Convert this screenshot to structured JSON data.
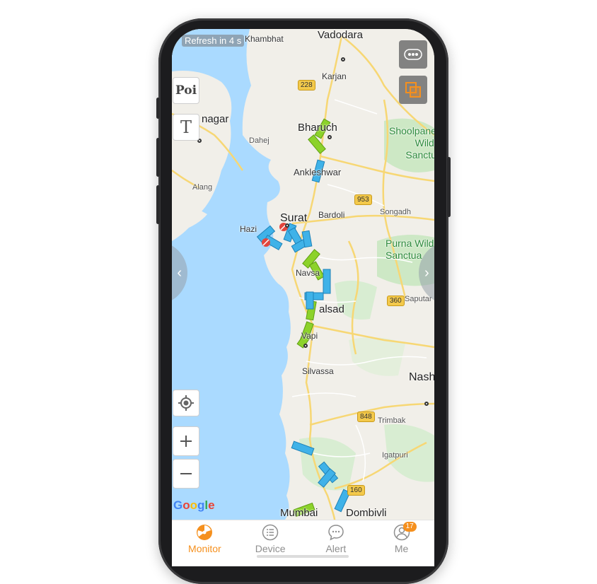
{
  "status": {
    "refresh_text": "Refresh in 4 s"
  },
  "map": {
    "labels": {
      "khambhat": "Khambhat",
      "vadodara": "Vadodara",
      "karjan": "Karjan",
      "nagar": "nagar",
      "bharuch": "Bharuch",
      "dahej": "Dahej",
      "shoolpaneshwar": "Shoolpane\nWildl\nSanctu",
      "ankleshwar": "Ankleshwar",
      "alang": "Alang",
      "surat": "Surat",
      "bardoli": "Bardoli",
      "songadh": "Songadh",
      "hazira": "Hazi",
      "purna": "Purna Wild\nSanctua",
      "navsari": "Navsa",
      "valsad": "alsad",
      "saputara": "Saputar",
      "vapi": "Vapi",
      "silvassa": "Silvassa",
      "nashik": "Nash",
      "trimbak": "Trimbak",
      "igatpuri": "Igatpuri",
      "mumbai": "Mumbai",
      "dombivli": "Dombivli"
    },
    "shields": {
      "s228": "228",
      "s953": "953",
      "s360": "360",
      "s848": "848",
      "s160": "160"
    },
    "attribution": "Google"
  },
  "tools": {
    "poi_label": "Poi",
    "text_label": "T"
  },
  "colors": {
    "water": "#aadaff",
    "land": "#f1efe9",
    "park": "#cde8c5",
    "road_major": "#f7d774",
    "road_minor": "#ffffff",
    "vehicle_green": "#8cd22a",
    "vehicle_blue": "#3fb2e8",
    "vehicle_red": "#e2453d",
    "accent": "#f5901e",
    "inactive": "#8e8e8e"
  },
  "tabs": [
    {
      "label": "Monitor",
      "icon": "monitor-icon",
      "active": true
    },
    {
      "label": "Device",
      "icon": "list-icon",
      "active": false
    },
    {
      "label": "Alert",
      "icon": "chat-icon",
      "active": false
    },
    {
      "label": "Me",
      "icon": "user-icon",
      "active": false,
      "badge": "17"
    }
  ]
}
